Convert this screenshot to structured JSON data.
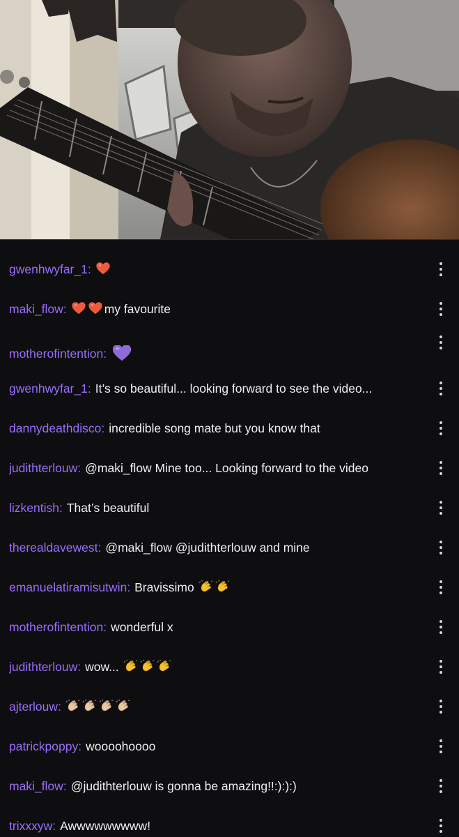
{
  "video": {
    "label": ""
  },
  "chat": {
    "messages": [
      {
        "user": "gwenhwyfar_1",
        "emojis": [
          "red-heart"
        ],
        "text": ""
      },
      {
        "user": "maki_flow",
        "emojis": [
          "red-heart",
          "red-heart"
        ],
        "text": "my favourite"
      },
      {
        "user": "motherofintention",
        "emojis": [
          "purple-heart"
        ],
        "text": ""
      },
      {
        "user": "gwenhwyfar_1",
        "emojis": [],
        "text": "It’s so beautiful... looking forward to see the video..."
      },
      {
        "user": "dannydeathdisco",
        "emojis": [],
        "text": "incredible song mate but you know that"
      },
      {
        "user": "judithterlouw",
        "emojis": [],
        "text": "@maki_flow Mine too... Looking forward to the video"
      },
      {
        "user": "lizkentish",
        "emojis": [],
        "text": "That’s beautiful"
      },
      {
        "user": "therealdavewest",
        "emojis": [],
        "text": "@maki_flow @judithterlouw and mine"
      },
      {
        "user": "emanuelatiramisutwin",
        "emojis_after": [
          "clap",
          "clap"
        ],
        "text": "Bravissimo"
      },
      {
        "user": "motherofintention",
        "emojis": [],
        "text": "wonderful x"
      },
      {
        "user": "judithterlouw",
        "emojis_after": [
          "clap",
          "clap",
          "clap"
        ],
        "text": "wow..."
      },
      {
        "user": "ajterlouw",
        "emojis": [
          "clap-light",
          "clap-light",
          "clap-light",
          "clap-light"
        ],
        "text": ""
      },
      {
        "user": "patrickpoppy",
        "emojis": [],
        "text": "woooohoooo"
      },
      {
        "user": "maki_flow",
        "emojis": [],
        "text": "@judithterlouw is gonna be amazing!!:):):)"
      },
      {
        "user": "trixxxyw",
        "emojis": [],
        "text": "Awwwwwwwww!"
      }
    ],
    "more_icon": "more-vertical-icon"
  },
  "colors": {
    "background": "#0e0e10",
    "username": "#9b6cff",
    "message_text": "#efeff1"
  }
}
